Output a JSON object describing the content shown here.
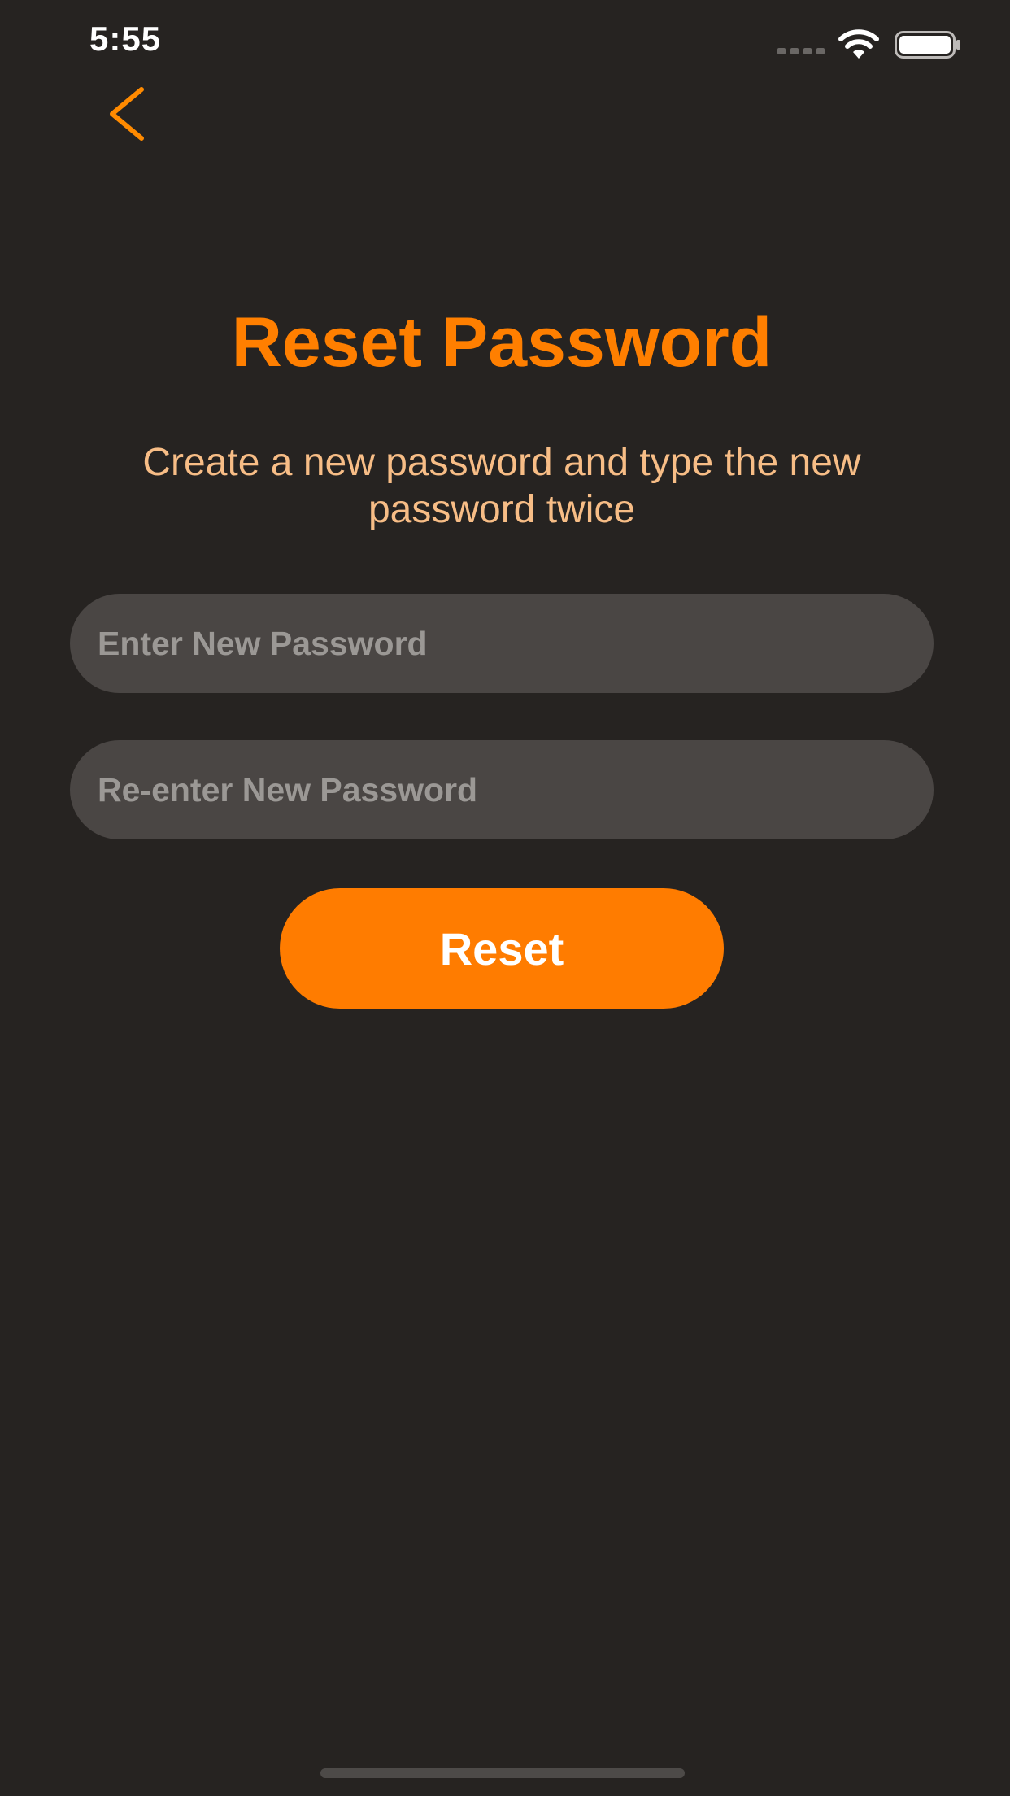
{
  "status_bar": {
    "time": "5:55",
    "icons": [
      "signal-icon",
      "wifi-icon",
      "battery-icon"
    ]
  },
  "nav": {
    "back_icon": "chevron-left-icon"
  },
  "header": {
    "title": "Reset Password",
    "subtitle": "Create a new password and type the new password twice"
  },
  "form": {
    "new_password_placeholder": "Enter New Password",
    "new_password_value": "",
    "confirm_password_placeholder": "Re-enter New Password",
    "confirm_password_value": "",
    "reset_label": "Reset"
  },
  "colors": {
    "background": "#262321",
    "accent": "#FF7F00",
    "subtitle": "#F7BD86",
    "field_background": "#4A4644",
    "placeholder": "#9B9895"
  }
}
